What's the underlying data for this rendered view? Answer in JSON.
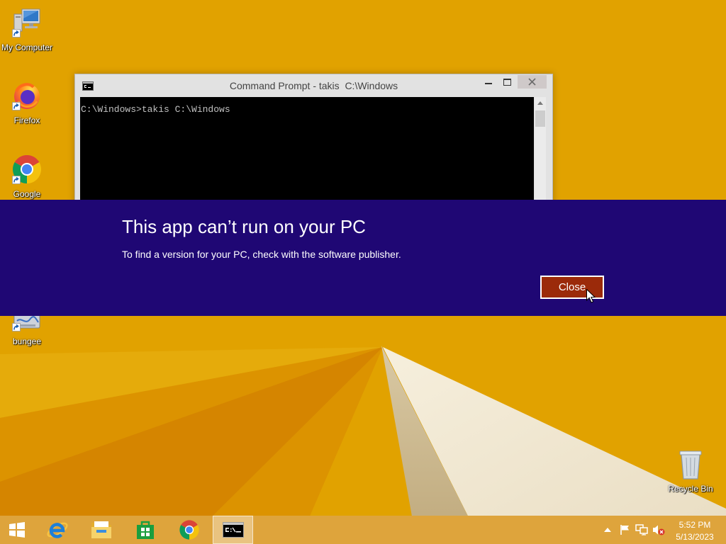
{
  "desktop": {
    "icons": [
      {
        "label": "My Computer",
        "icon": "computer-icon"
      },
      {
        "label": "Firefox",
        "icon": "firefox-icon"
      },
      {
        "label": "Google",
        "icon": "chrome-icon"
      },
      {
        "label": "bungee",
        "icon": "bungee-app-icon"
      }
    ],
    "recycle_bin": {
      "label": "Recycle Bin",
      "icon": "recycle-bin-icon"
    }
  },
  "cmd_window": {
    "title": "Command Prompt - takis  C:\\Windows",
    "icon": "cmd-icon",
    "console_lines": [
      "C:\\Windows>takis C:\\Windows"
    ],
    "controls": {
      "minimize": "minimize-icon",
      "maximize": "maximize-icon",
      "close": "close-icon"
    }
  },
  "dialog": {
    "title": "This app can’t run on your PC",
    "message": "To find a version for your PC, check with the software publisher.",
    "close_label": "Close"
  },
  "taskbar": {
    "items": [
      {
        "icon": "windows-start-icon"
      },
      {
        "icon": "internet-explorer-icon"
      },
      {
        "icon": "file-explorer-icon"
      },
      {
        "icon": "windows-store-icon"
      },
      {
        "icon": "chrome-icon"
      },
      {
        "icon": "cmd-icon",
        "active": true
      }
    ],
    "tray": {
      "icons": [
        "show-hidden-icons-icon",
        "action-center-flag-icon",
        "network-icon",
        "volume-muted-icon"
      ],
      "time": "5:52 PM",
      "date": "5/13/2023"
    }
  },
  "theme": {
    "wallpaper": "#e1a200",
    "banner": "#1f0774",
    "close_button": "#9b2a0a",
    "taskbar": "#dea43c",
    "console": "#000000",
    "console_text": "#c0c0c0"
  }
}
